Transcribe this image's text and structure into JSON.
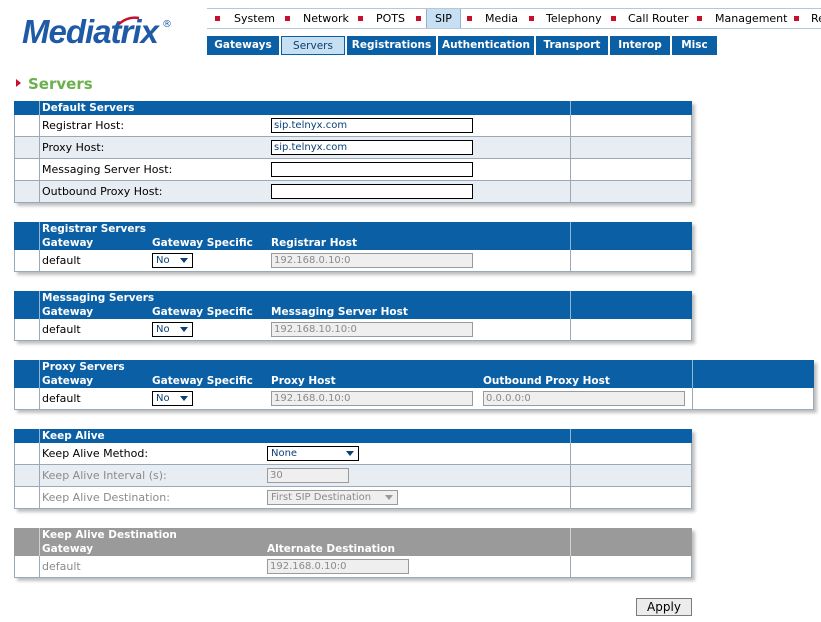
{
  "brand": {
    "name": "Mediatrix",
    "reg": "®"
  },
  "top_menu": [
    "System",
    "Network",
    "POTS",
    "SIP",
    "Media",
    "Telephony",
    "Call Router",
    "Management",
    "Re"
  ],
  "sub_tabs": [
    "Gateways",
    "Servers",
    "Registrations",
    "Authentication",
    "Transport",
    "Interop",
    "Misc"
  ],
  "page_title": "Servers",
  "default_servers": {
    "title": "Default Servers",
    "rows": [
      {
        "label": "Registrar Host:",
        "value": "sip.telnyx.com"
      },
      {
        "label": "Proxy Host:",
        "value": "sip.telnyx.com"
      },
      {
        "label": "Messaging Server Host:",
        "value": ""
      },
      {
        "label": "Outbound Proxy Host:",
        "value": ""
      }
    ]
  },
  "registrar_servers": {
    "title": "Registrar Servers",
    "columns": [
      "Gateway",
      "Gateway Specific",
      "Registrar Host"
    ],
    "row": {
      "gateway": "default",
      "specific": "No",
      "host": "192.168.0.10:0"
    }
  },
  "messaging_servers": {
    "title": "Messaging Servers",
    "columns": [
      "Gateway",
      "Gateway Specific",
      "Messaging Server Host"
    ],
    "row": {
      "gateway": "default",
      "specific": "No",
      "host": "192.168.10.10:0"
    }
  },
  "proxy_servers": {
    "title": "Proxy Servers",
    "columns": [
      "Gateway",
      "Gateway Specific",
      "Proxy Host",
      "Outbound Proxy Host"
    ],
    "row": {
      "gateway": "default",
      "specific": "No",
      "host": "192.168.0.10:0",
      "outbound": "0.0.0.0:0"
    }
  },
  "keep_alive": {
    "title": "Keep Alive",
    "method_label": "Keep Alive Method:",
    "method_value": "None",
    "interval_label": "Keep Alive Interval (s):",
    "interval_value": "30",
    "destination_label": "Keep Alive Destination:",
    "destination_value": "First SIP Destination"
  },
  "keep_alive_destination": {
    "title": "Keep Alive Destination",
    "columns": [
      "Gateway",
      "Alternate Destination"
    ],
    "row": {
      "gateway": "default",
      "alternate": "192.168.0.10:0"
    }
  },
  "apply_label": "Apply",
  "colors": {
    "header_blue": "#0b5fa5",
    "title_green": "#6ab04c",
    "bullet_red": "#c8102e",
    "disabled_grey": "#9a9a9a"
  }
}
